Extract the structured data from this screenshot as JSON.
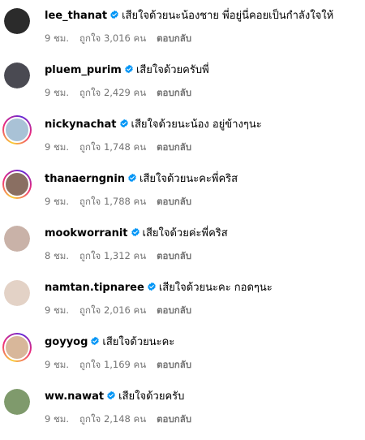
{
  "comments": [
    {
      "username": "lee_thanat",
      "text": "เสียใจด้วยนะน้องชาย พี่อยู่นี่คอยเป็นกำลังใจให้ ",
      "time": "9 ชม.",
      "likes": "ถูกใจ 3,016 คน",
      "reply": "ตอบกลับ",
      "avatar_icon": "profile-photo",
      "avatar_color": "#2b2b2b",
      "story_ring": false
    },
    {
      "username": "pluem_purim",
      "text": "เสียใจด้วยครับพี่",
      "time": "9 ชม.",
      "likes": "ถูกใจ 2,429 คน",
      "reply": "ตอบกลับ",
      "avatar_icon": "profile-photo",
      "avatar_color": "#4a4a52",
      "story_ring": false
    },
    {
      "username": "nickynachat",
      "text": "เสียใจด้วยนะน้อง อยู่ข้างๆนะ",
      "time": "9 ชม.",
      "likes": "ถูกใจ 1,748 คน",
      "reply": "ตอบกลับ",
      "avatar_icon": "profile-photo",
      "avatar_color": "#a9c2d6",
      "story_ring": true
    },
    {
      "username": "thanaerngnin",
      "text": "เสียใจด้วยนะคะพี่คริส",
      "time": "9 ชม.",
      "likes": "ถูกใจ 1,788 คน",
      "reply": "ตอบกลับ",
      "avatar_icon": "profile-photo",
      "avatar_color": "#8a6f62",
      "story_ring": true
    },
    {
      "username": "mookworranit",
      "text": "เสียใจด้วยค่ะพี่คริส",
      "time": "8 ชม.",
      "likes": "ถูกใจ 1,312 คน",
      "reply": "ตอบกลับ",
      "avatar_icon": "profile-photo",
      "avatar_color": "#c9b2a8",
      "story_ring": false
    },
    {
      "username": "namtan.tipnaree",
      "text": "เสียใจด้วยนะคะ กอดๆนะ ",
      "time": "9 ชม.",
      "likes": "ถูกใจ 2,016 คน",
      "reply": "ตอบกลับ",
      "avatar_icon": "profile-photo",
      "avatar_color": "#e3d2c6",
      "story_ring": false
    },
    {
      "username": "goyyog",
      "text": "เสียใจด้วยนะคะ",
      "time": "9 ชม.",
      "likes": "ถูกใจ 1,169 คน",
      "reply": "ตอบกลับ",
      "avatar_icon": "profile-photo",
      "avatar_color": "#d8b79a",
      "story_ring": true
    },
    {
      "username": "ww.nawat",
      "text": "เสียใจด้วยครับ",
      "time": "9 ชม.",
      "likes": "ถูกใจ 2,148 คน",
      "reply": "ตอบกลับ",
      "avatar_icon": "profile-photo",
      "avatar_color": "#7f9a6c",
      "story_ring": false
    }
  ],
  "colors": {
    "verified_badge": "#0095f6",
    "meta_text": "#737373",
    "primary_text": "#000000"
  },
  "icons": {
    "verified": "verified-badge-icon"
  }
}
